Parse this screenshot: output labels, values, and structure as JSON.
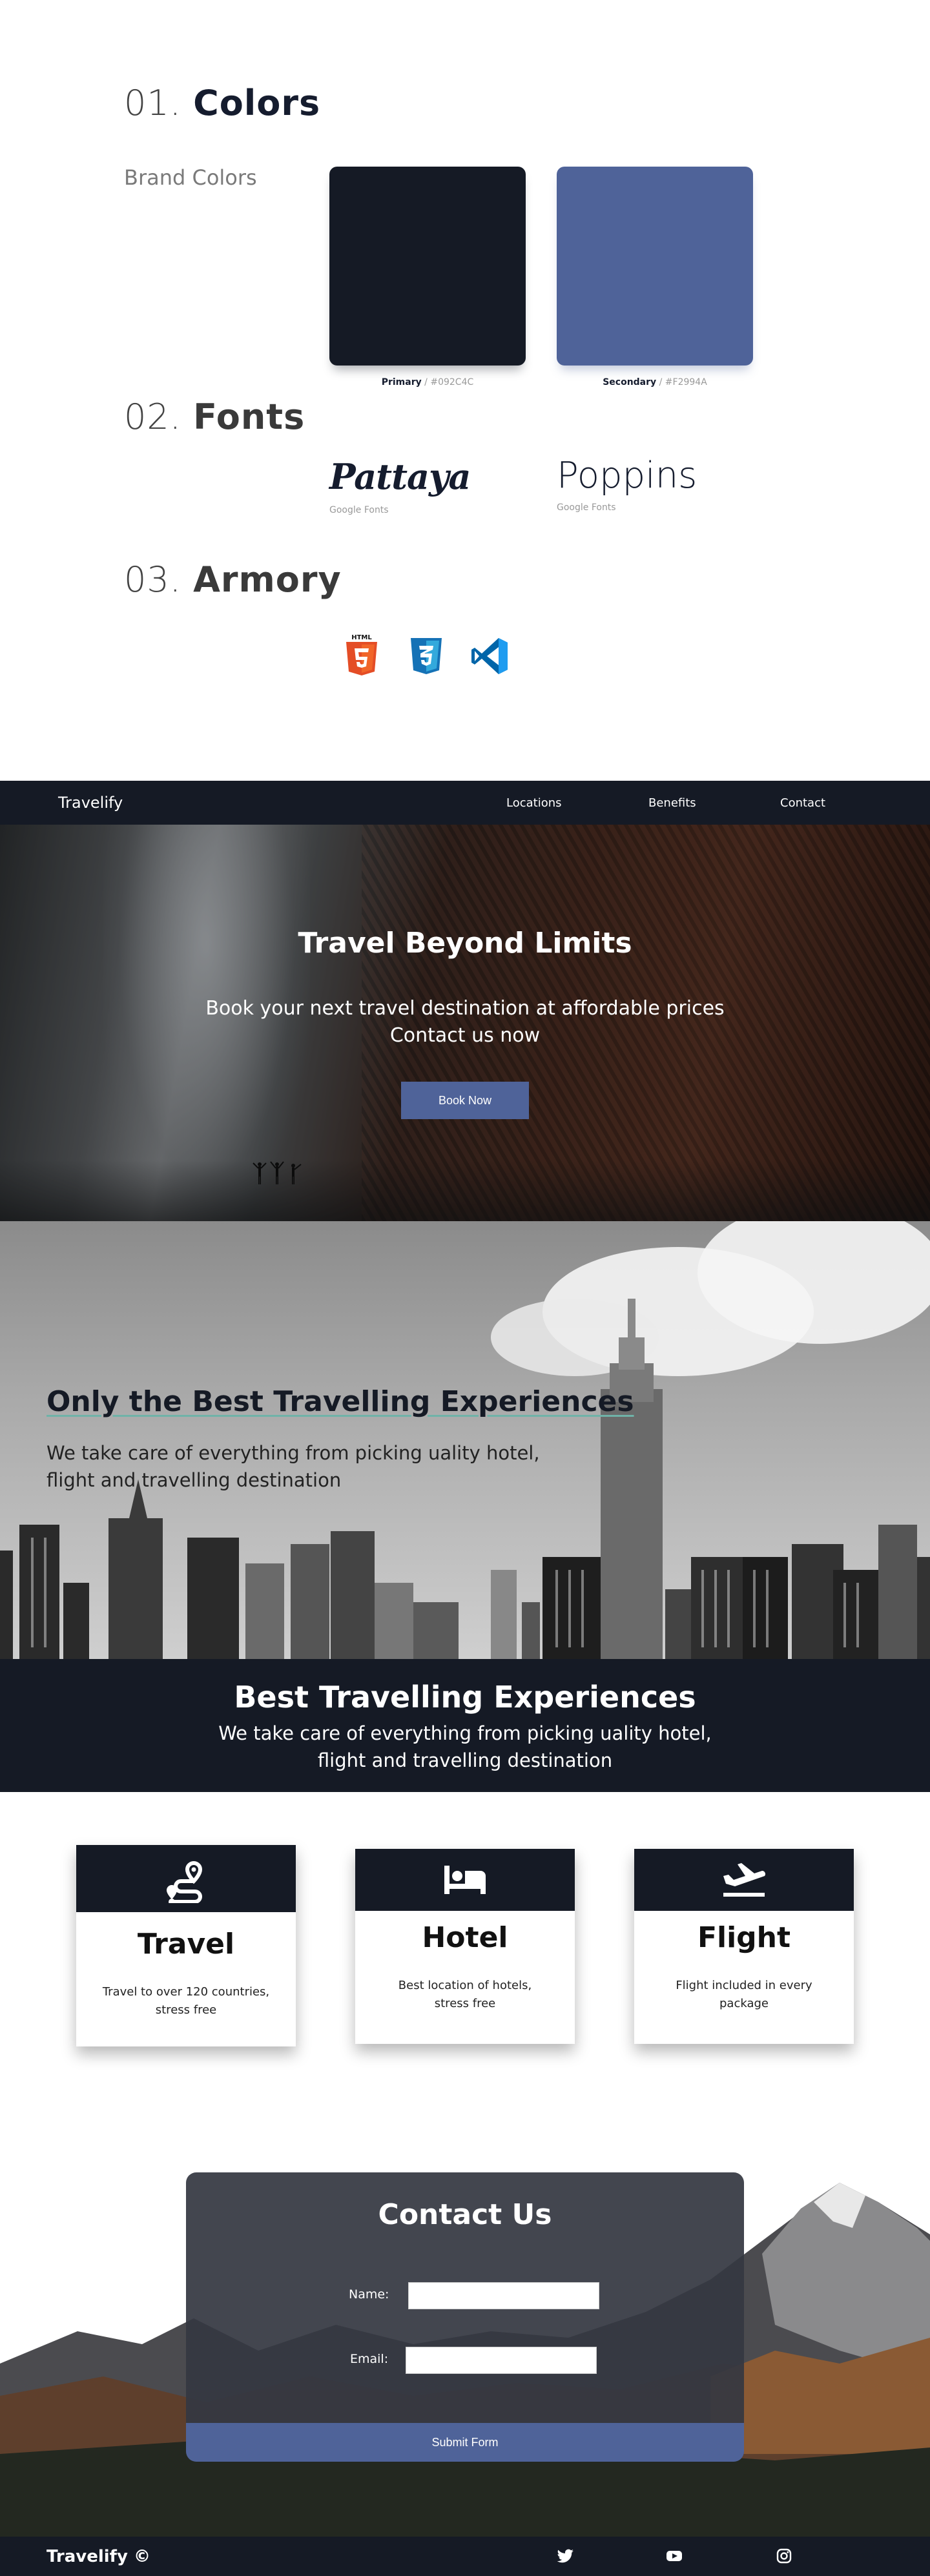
{
  "styleguide": {
    "colors": {
      "num": "01.",
      "word": "Colors"
    },
    "brand_label": "Brand Colors",
    "primary": {
      "name": "Primary",
      "sep": " / ",
      "hex": "#092C4C"
    },
    "secondary": {
      "name": "Secondary",
      "sep": " / ",
      "hex": "#F2994A"
    },
    "fonts": {
      "num": "02.",
      "word": "Fonts"
    },
    "font_a": {
      "name": "Pattaya",
      "source": "Google Fonts"
    },
    "font_b": {
      "name": "Poppins",
      "source": "Google Fonts"
    },
    "armory": {
      "num": "03.",
      "word": "Armory"
    },
    "icons": [
      "html5-icon",
      "css3-icon",
      "vscode-icon"
    ],
    "swatch_colors": {
      "primary_display": "#151a25",
      "secondary_display": "#4f6399"
    }
  },
  "nav": {
    "logo": "Travelify",
    "links": [
      "Locations",
      "Benefits",
      "Contact"
    ]
  },
  "hero": {
    "title": "Travel Beyond Limits",
    "subtitle_line1": "Book your next travel destination at affordable prices",
    "subtitle_line2": "Contact us now",
    "button": "Book Now"
  },
  "city": {
    "title": "Only the Best Travelling Experiences",
    "subtitle_line1": "We take care of everything from picking uality hotel,",
    "subtitle_line2": "flight and travelling destination"
  },
  "band": {
    "title": "Best Travelling Experiences",
    "subtitle_line1": "We take care of everything from picking uality hotel,",
    "subtitle_line2": "flight and travelling destination"
  },
  "cards": [
    {
      "icon": "route-icon",
      "title": "Travel",
      "text": "Travel to over 120 countries, stress free"
    },
    {
      "icon": "bed-icon",
      "title": "Hotel",
      "text": "Best location of hotels, stress free"
    },
    {
      "icon": "plane-icon",
      "title": "Flight",
      "text": "Flight included in every package"
    }
  ],
  "contact": {
    "title": "Contact Us",
    "name_label": "Name:",
    "email_label": "Email:",
    "name_value": "",
    "email_value": "",
    "submit": "Submit Form"
  },
  "footer": {
    "brand": "Travelify ©",
    "social": [
      "twitter-icon",
      "youtube-icon",
      "instagram-icon"
    ]
  },
  "colors": {
    "dark": "#151a25",
    "accent": "#4f6399"
  }
}
